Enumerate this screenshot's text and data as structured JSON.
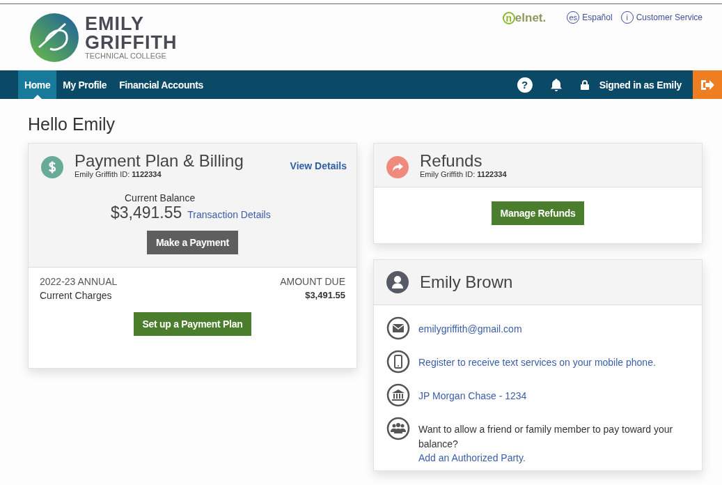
{
  "brand": {
    "name_line1": "EMILY",
    "name_line2": "GRIFFITH",
    "subtitle": "TECHNICAL COLLEGE"
  },
  "partner_logo": {
    "mark": "n",
    "text": "elnet."
  },
  "top_links": [
    {
      "badge": "es",
      "label": "Español"
    },
    {
      "badge": "i",
      "label": "Customer Service"
    }
  ],
  "nav": {
    "tabs": [
      {
        "label": "Home",
        "selected": true
      },
      {
        "label": "My Profile",
        "selected": false
      },
      {
        "label": "Financial Accounts",
        "selected": false
      }
    ],
    "help": "?",
    "user": "Signed in as Emily"
  },
  "greeting": "Hello Emily",
  "billing": {
    "title": "Payment Plan & Billing",
    "id_line": "Emily Griffith ID: **1122334**",
    "view_link": "View Details",
    "balance_label": "Current Balance",
    "balance": "$3,491.55",
    "transactions_link": "Transaction Details",
    "pay_button": "Make a Payment",
    "term": "2022-23 ANNUAL",
    "charges_label": "Current Charges",
    "due_label": "AMOUNT DUE",
    "due": "$3,491.55",
    "plan_button": "Set up a Payment Plan"
  },
  "refunds": {
    "title": "Refunds",
    "id_line": "Emily Griffith ID: **1122334**",
    "button": "Manage Refunds"
  },
  "profile": {
    "name": "Emily Brown",
    "items": [
      {
        "kind": "email",
        "text": "emilygriffith@gmail.com"
      },
      {
        "kind": "phone",
        "text": "Register to receive text services on your mobile phone."
      },
      {
        "kind": "bank",
        "text": "JP Morgan Chase - 1234"
      },
      {
        "kind": "party",
        "text": "Want to allow a friend or family member to pay toward your balance?",
        "link": "Add an Authorized Party."
      }
    ]
  }
}
